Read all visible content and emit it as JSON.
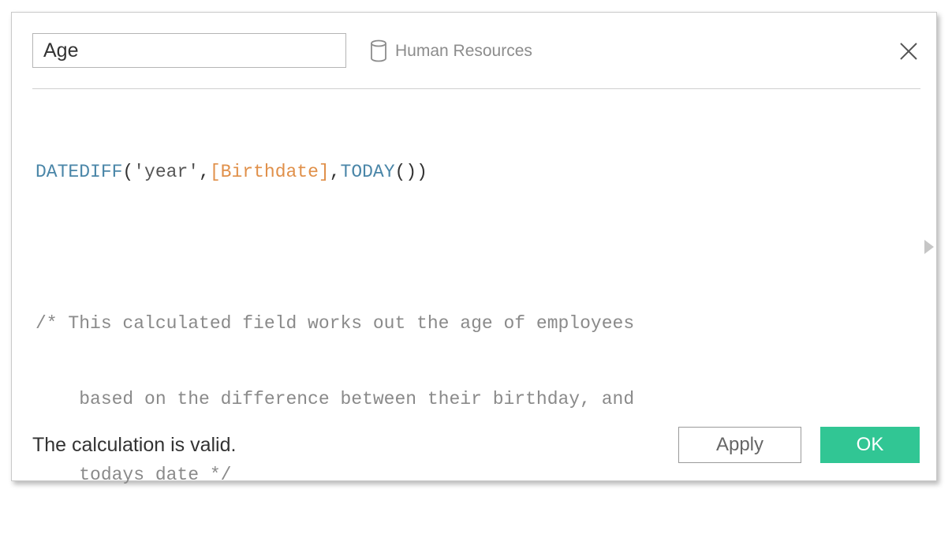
{
  "dialog": {
    "field_name": "Age",
    "datasource": {
      "icon": "database-icon",
      "label": "Human Resources"
    },
    "close_icon": "close-icon"
  },
  "editor": {
    "formula": {
      "func1": "DATEDIFF",
      "open1": "(",
      "str": "'year'",
      "comma1": ",",
      "field": "[Birthdate]",
      "comma2": ",",
      "func2": "TODAY",
      "close": "())"
    },
    "comment": [
      "/* This calculated field works out the age of employees",
      "    based on the difference between their birthday, and",
      "    todays date */"
    ]
  },
  "footer": {
    "status": "The calculation is valid.",
    "apply_label": "Apply",
    "ok_label": "OK"
  },
  "colors": {
    "ok_button": "#31c694",
    "function": "#4a86a8",
    "field": "#e0904a",
    "comment": "#8a8a8a"
  }
}
